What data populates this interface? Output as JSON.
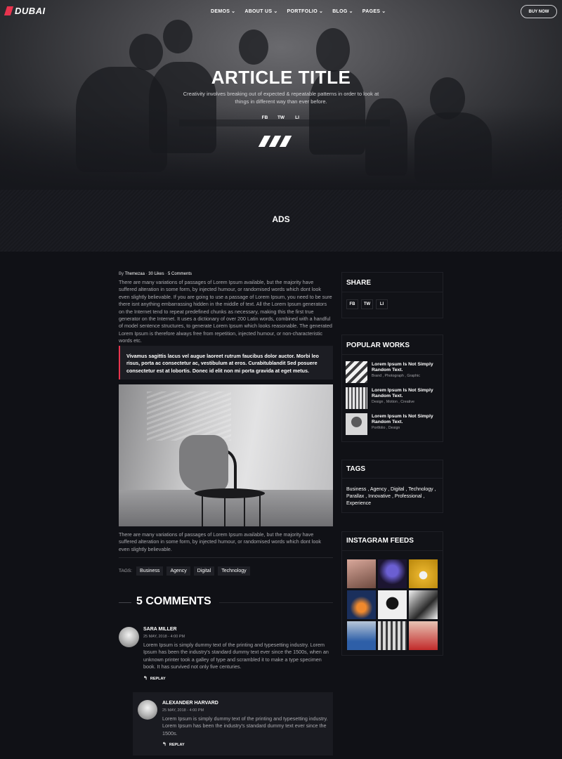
{
  "nav": {
    "logo": "DUBAI",
    "menu": [
      {
        "label": "DEMOS"
      },
      {
        "label": "ABOUT US"
      },
      {
        "label": "PORTFOLIO"
      },
      {
        "label": "BLOG"
      },
      {
        "label": "PAGES"
      }
    ],
    "cta": "BUY NOW"
  },
  "hero": {
    "title": "ARTICLE TITLE",
    "subtitle": "Creativity involves breaking out of expected & repeatable patterns in order to look at things in different way than ever before.",
    "social": [
      "FB",
      "TW",
      "LI"
    ]
  },
  "ads": {
    "label": "ADS"
  },
  "article": {
    "meta": {
      "by": "By",
      "author": "Themezaa",
      "likes": "30 Likes",
      "comments": "5 Comments"
    },
    "para1": "There are many variations of passages of Lorem Ipsum available, but the majority have suffered alteration in some form, by injected humour, or randomised words which dont look even slightly believable. If you are going to use a passage of Lorem Ipsum, you need to be sure there isnt anything embarrassing hidden in the middle of text. All the Lorem Ipsum generators on the Internet tend to repeat predefined chunks as necessary, making this the first true generator on the Internet. It uses a dictionary of over 200 Latin words, combined with a handful of model sentence structures, to generate Lorem Ipsum which looks reasonable. The generated Lorem Ipsum is therefore always free from repetition, injected humour, or non-characteristic words etc.",
    "quote": "Vivamus sagittis lacus vel augue laoreet rutrum faucibus dolor auctor. Morbi leo risus, porta ac consectetur ac, vestibulum at eros. Curabitublandit Sed posuere consectetur est at lobortis. Donec id elit non mi porta gravida at eget metus.",
    "para2": "There are many variations of passages of Lorem Ipsum available, but the majority have suffered alteration in some form, by injected humour, or randomised words which dont look even slightly believable.",
    "tags_label": "TAGS:",
    "tags": [
      "Business",
      "Agency",
      "Digital",
      "Technology"
    ]
  },
  "comments": {
    "title": "5 COMMENTS",
    "items": [
      {
        "name": "SARA MILLER",
        "date": "25 MAY, 2018 - 4:00 PM",
        "text": "Lorem Ipsum is simply dummy text of the printing and typesetting industry. Lorem Ipsum has been the industry's standard dummy text ever since the 1500s, when an unknown printer took a galley of type and scrambled it to make a type specimen book. It has survived not only five centuries.",
        "reply": "REPLAY"
      },
      {
        "name": "ALEXANDER HARVARD",
        "date": "25 MAY, 2018 - 4:00 PM",
        "text": "Lorem Ipsum is simply dummy text of the printing and typesetting industry. Lorem Ipsum has been the industry's standard dummy text ever since the 1500s.",
        "reply": "REPLAY"
      }
    ]
  },
  "sidebar": {
    "share": {
      "title": "SHARE",
      "buttons": [
        "FB",
        "TW",
        "LI"
      ]
    },
    "popular": {
      "title": "POPULAR WORKS",
      "items": [
        {
          "title": "Lorem Ipsum Is Not Simply Random Text.",
          "cats": "Brand , Photograph , Graphic"
        },
        {
          "title": "Lorem Ipsum Is Not Simply Random Text.",
          "cats": "Design , Motion , Creative"
        },
        {
          "title": "Lorem Ipsum Is Not Simply Random Text.",
          "cats": "Portfolio , Design"
        }
      ]
    },
    "tags": {
      "title": "TAGS",
      "text": "Business , Agency , Digital , Technology , Parallax , Innovative , Professional , Experience"
    },
    "instagram": {
      "title": "INSTAGRAM FEEDS"
    }
  },
  "colors": {
    "accent": "#e8344e",
    "background": "#101116",
    "panel": "#1c1d23"
  }
}
